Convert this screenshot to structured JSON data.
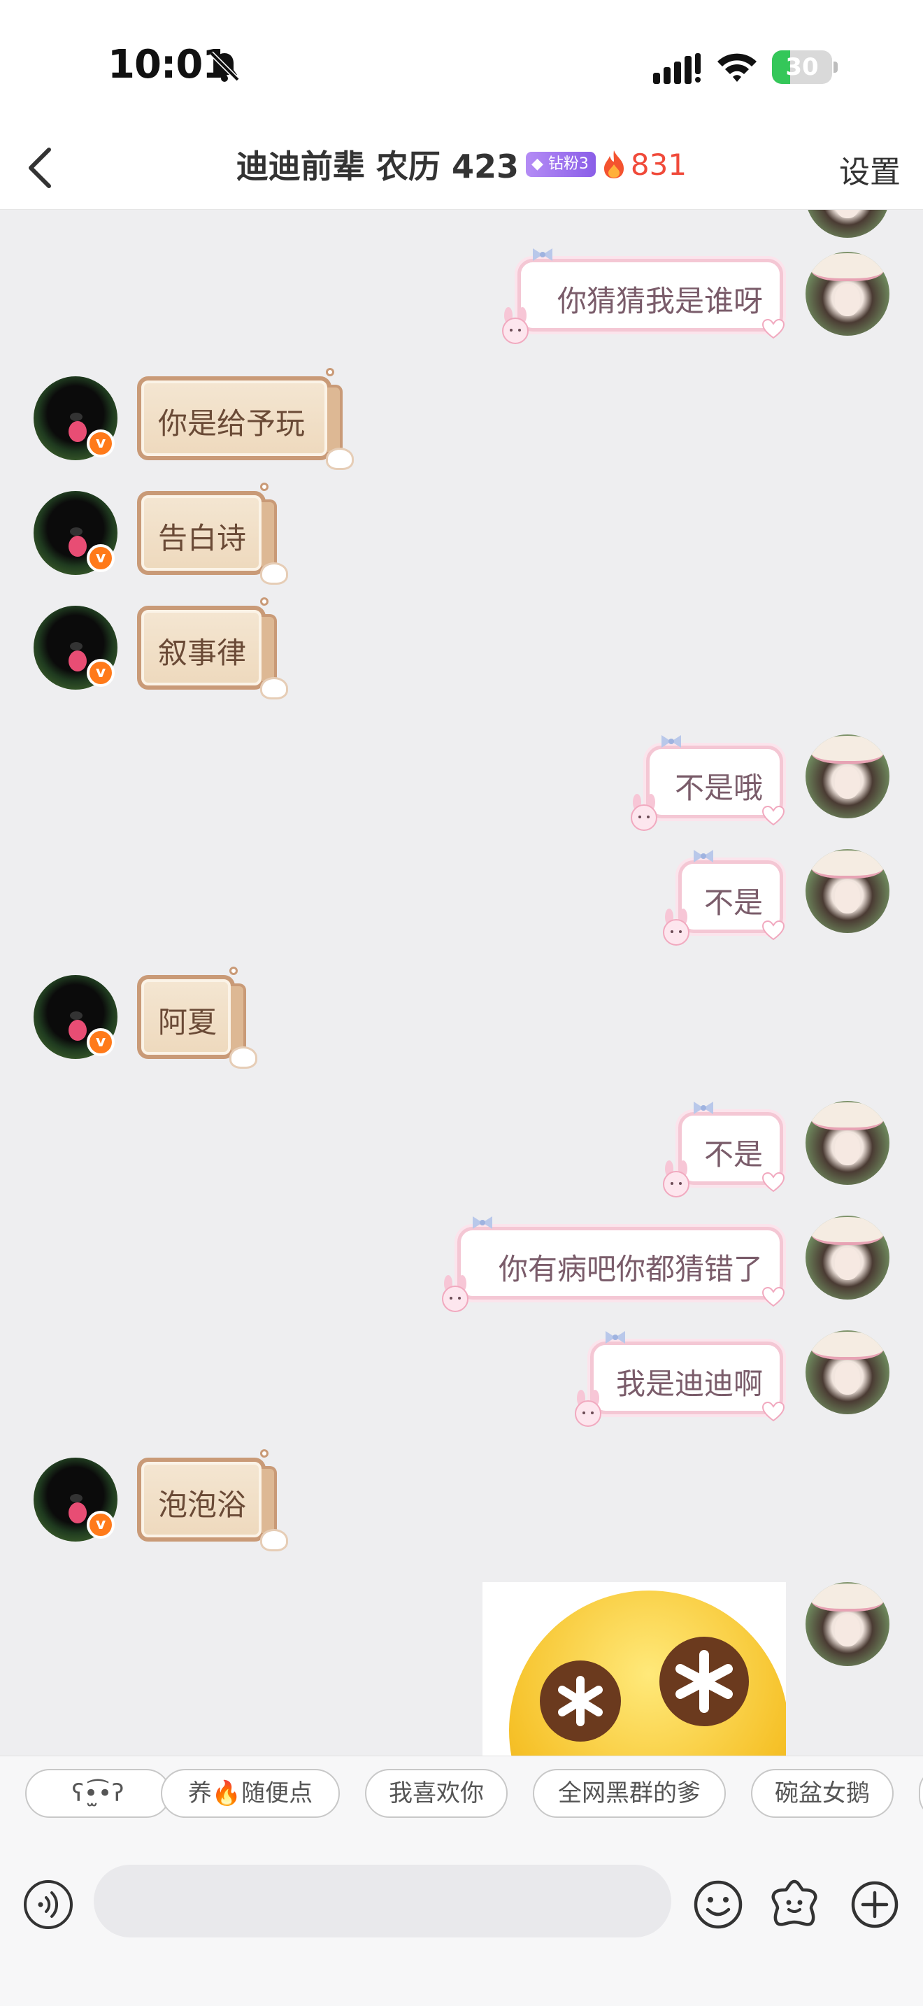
{
  "status_bar": {
    "time": "10:01",
    "battery_level": "30",
    "battery_fraction": 0.3,
    "battery_color": "#34c759"
  },
  "header": {
    "title": "迪迪前辈 农历 423",
    "fan_badge": "钻粉3",
    "streak_count": "831",
    "settings_label": "设置",
    "back_icon": "chevron-left-icon"
  },
  "messages": [
    {
      "side": "right",
      "text": "你猜猜我是谁呀"
    },
    {
      "side": "left",
      "text": "你是给予玩"
    },
    {
      "side": "left",
      "text": "告白诗"
    },
    {
      "side": "left",
      "text": "叙事律"
    },
    {
      "side": "right",
      "text": "不是哦"
    },
    {
      "side": "right",
      "text": "不是"
    },
    {
      "side": "left",
      "text": "阿夏"
    },
    {
      "side": "right",
      "text": "不是"
    },
    {
      "side": "right",
      "text": "你有病吧你都猜错了"
    },
    {
      "side": "right",
      "text": "我是迪迪啊"
    },
    {
      "side": "left",
      "text": "泡泡浴"
    },
    {
      "side": "right",
      "type": "sticker",
      "sticker": "dizzy-eyes-emoji"
    }
  ],
  "quick_replies": [
    "ʕ•̫͡•ʔ",
    "养🔥随便点",
    "我喜欢你",
    "全网黑群的爹",
    "碗盆女鹅"
  ],
  "input": {
    "placeholder": "",
    "icons": [
      "voice-icon",
      "emoji-icon",
      "sticker-icon",
      "plus-icon"
    ]
  },
  "colors": {
    "accent_pink": "#f4c7d4",
    "bubble_brown": "#c99a77",
    "streak_red": "#f04a3a",
    "fan_purple": "#8a5ee8"
  }
}
